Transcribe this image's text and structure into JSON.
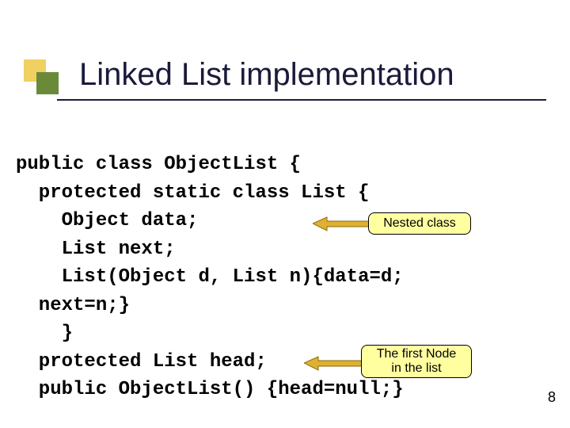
{
  "title": "Linked List implementation",
  "code": {
    "line1": "public class ObjectList {",
    "line2": "  protected static class List {",
    "line3": "    Object data;",
    "line4": "    List next;",
    "line5": "    List(Object d, List n){data=d;",
    "line6": "  next=n;}",
    "line7": "    }",
    "line8": "  protected List head;",
    "line9": "  public ObjectList() {head=null;}"
  },
  "callouts": {
    "nested": "Nested class",
    "first_node_l1": "The first Node",
    "first_node_l2": "in the list"
  },
  "page_number": "8"
}
